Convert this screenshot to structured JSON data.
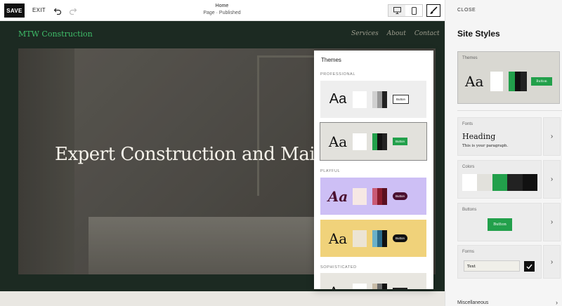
{
  "toolbar": {
    "save_label": "SAVE",
    "exit_label": "EXIT",
    "page_title": "Home",
    "page_status": "Page · Published"
  },
  "site": {
    "logo": "MTW Construction",
    "nav": [
      "Services",
      "About",
      "Contact"
    ],
    "hero_title": "Expert Construction and Maintenance"
  },
  "themes_panel": {
    "title": "Themes",
    "categories": [
      "PROFESSIONAL",
      "PLAYFUL",
      "SOPHISTICATED"
    ],
    "cards": [
      {
        "aa": "Aa",
        "button": "Button",
        "bg": "#eeeeee",
        "fg": "#111111",
        "light": "#ffffff",
        "strip": [
          "#d0d0d0",
          "#9a9a9a",
          "#222222"
        ],
        "btn_bg": "#ffffff",
        "btn_fg": "#111111"
      },
      {
        "aa": "Aa",
        "button": "Button",
        "bg": "#e2e1dc",
        "fg": "#111111",
        "light": "#ffffff",
        "strip": [
          "#22a04b",
          "#111111",
          "#222222"
        ],
        "btn_bg": "#22a04b",
        "btn_fg": "#ffffff"
      },
      {
        "aa": "Aa",
        "button": "Button",
        "bg": "#cdbff5",
        "fg": "#4a1030",
        "light": "#f6e8e4",
        "strip": [
          "#c95a75",
          "#8a1c2c",
          "#5a1020"
        ],
        "btn_bg": "#4a1030",
        "btn_fg": "#ffffff"
      },
      {
        "aa": "Aa",
        "button": "Button",
        "bg": "#f0d27a",
        "fg": "#111111",
        "light": "#ece4d4",
        "strip": [
          "#6ab0c8",
          "#2a6a8a",
          "#111111"
        ],
        "btn_bg": "#111111",
        "btn_fg": "#ffffff"
      },
      {
        "aa": "Aa",
        "button": "Button",
        "bg": "#e8e6e0",
        "fg": "#111111",
        "light": "#ffffff",
        "strip": [
          "#c8bca8",
          "#6a6a6a",
          "#111111"
        ],
        "btn_bg": "#222222",
        "btn_fg": "#ffffff"
      }
    ]
  },
  "sidebar": {
    "close_label": "CLOSE",
    "title": "Site Styles",
    "theme_label": "Themes",
    "theme_aa": "Aa",
    "theme_button": "Button",
    "fonts_label": "Fonts",
    "fonts_heading": "Heading",
    "fonts_paragraph": "This is your paragraph.",
    "colors_label": "Colors",
    "buttons_label": "Buttons",
    "buttons_sample": "Button",
    "forms_label": "Forms",
    "forms_sample": "Text",
    "misc_label": "Miscellaneous"
  },
  "colors": {
    "accent_green": "#22a04b",
    "site_bg": "#1c2a22"
  }
}
